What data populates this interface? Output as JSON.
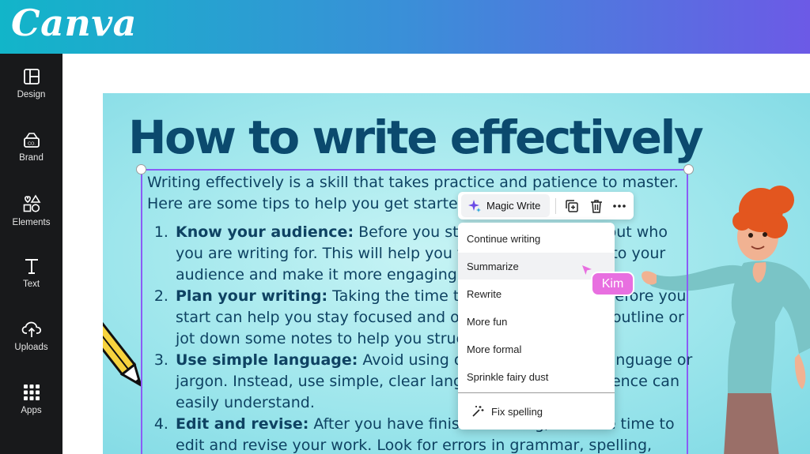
{
  "app": {
    "logo": "Canva",
    "brand_gradient": [
      "#12b5c9",
      "#6c5ae6"
    ]
  },
  "sidebar": {
    "items": [
      {
        "label": "Design",
        "icon": "layout-icon"
      },
      {
        "label": "Brand",
        "icon": "brand-icon"
      },
      {
        "label": "Elements",
        "icon": "shapes-icon"
      },
      {
        "label": "Text",
        "icon": "text-icon"
      },
      {
        "label": "Uploads",
        "icon": "cloud-upload-icon"
      },
      {
        "label": "Apps",
        "icon": "apps-grid-icon"
      }
    ]
  },
  "design": {
    "title": "How to write effectively",
    "intro": "Writing effectively is a skill that takes practice and patience to master. Here are some tips to help you get started:",
    "tips": [
      {
        "heading": "Know your audience:",
        "text": " Before you start writing, think about who you are writing for. This will help you tailor your message to your audience and make it more engaging."
      },
      {
        "heading": "Plan your writing:",
        "text": " Taking the time to plan your writing before you start can help you stay focused and organized. Create an outline or jot down some notes to help you structure your thoughts."
      },
      {
        "heading": "Use simple language:",
        "text": " Avoid using overly complicated language or jargon. Instead, use simple, clear language that your audience can easily understand."
      },
      {
        "heading": "Edit and revise:",
        "text": " After you have finished writing, take the time to edit and revise your work. Look for errors in grammar, spelling,"
      }
    ],
    "text_color": "#0e4262",
    "title_color": "#0b4a6e"
  },
  "toolbar": {
    "magic_write_label": "Magic Write",
    "icons": [
      "sparkle-icon",
      "duplicate-icon",
      "trash-icon",
      "more-icon"
    ]
  },
  "magic_menu": {
    "items": [
      "Continue writing",
      "Summarize",
      "Rewrite",
      "More fun",
      "More formal",
      "Sprinkle fairy dust"
    ],
    "hovered": "Summarize",
    "fix_spelling": "Fix spelling"
  },
  "collaborator": {
    "name": "Kim",
    "color": "#e86fe0"
  }
}
